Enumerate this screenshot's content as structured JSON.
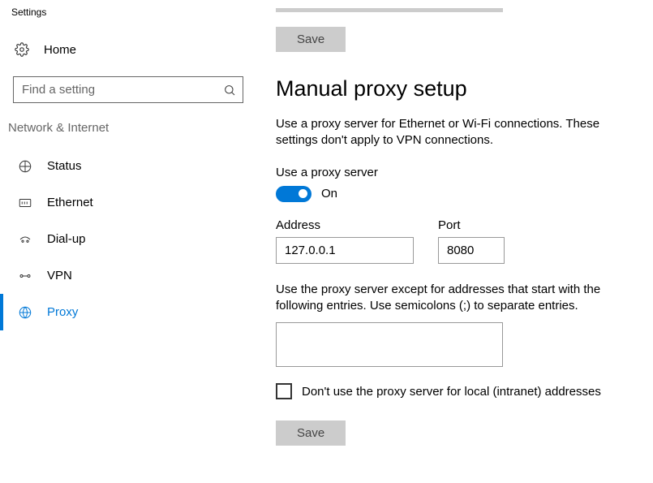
{
  "window": {
    "title": "Settings"
  },
  "sidebar": {
    "home_label": "Home",
    "search_placeholder": "Find a setting",
    "section_header": "Network & Internet",
    "items": [
      {
        "label": "Status"
      },
      {
        "label": "Ethernet"
      },
      {
        "label": "Dial-up"
      },
      {
        "label": "VPN"
      },
      {
        "label": "Proxy"
      }
    ]
  },
  "main": {
    "save_top": "Save",
    "heading": "Manual proxy setup",
    "description": "Use a proxy server for Ethernet or Wi-Fi connections. These settings don't apply to VPN connections.",
    "use_proxy_label": "Use a proxy server",
    "toggle_state": "On",
    "address_label": "Address",
    "address_value": "127.0.0.1",
    "port_label": "Port",
    "port_value": "8080",
    "except_desc": "Use the proxy server except for addresses that start with the following entries. Use semicolons (;) to separate entries.",
    "local_checkbox_label": "Don't use the proxy server for local (intranet) addresses",
    "save_bottom": "Save"
  }
}
